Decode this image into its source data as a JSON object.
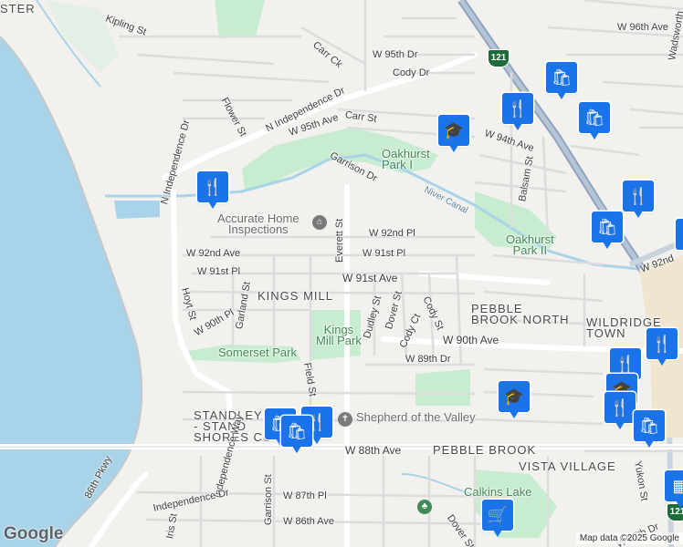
{
  "labels": {
    "ster": "STER",
    "kipling": "Kipling St",
    "carr_ck": "Carr Ck",
    "w95th_dr": "W 95th Dr",
    "cody_dr": "Cody Dr",
    "n_indep_dr": "N Independence Dr",
    "w95th_ave": "W 95th Ave",
    "carr_st": "Carr St",
    "flower_st": "Flower St",
    "indep_dr": "N Independence Dr",
    "garrison_dr": "Garrison Dr",
    "oakhurst_park1": "Oakhurst\nPark I",
    "w94th_ave": "W 94th Ave",
    "balsam_st": "Balsam St",
    "w96th_ave": "W 96th Ave",
    "wadsworth": "Wadsworth",
    "niver_canal": "Niver Canal",
    "w92nd_pl": "W 92nd Pl",
    "w91st_pl_n": "W 91st Pl",
    "w92nd_ave": "W 92nd Ave",
    "w91st_pl": "W 91st Pl",
    "w91st_ave": "W 91st Ave",
    "everett_st": "Everett St",
    "oakhurst_park2": "Oakhurst\nPark II",
    "w92nd_ave_e": "W 92nd",
    "kings_mill": "KINGS MILL",
    "hoyt_st": "Hoyt St",
    "w90th_pl": "W 90th Pl",
    "garland_st": "Garland St",
    "dudley_st": "Dudley St",
    "dover_st": "Dover St",
    "cody_ct": "Cody Ct",
    "cody_st": "Cody St",
    "pebble_brook_north": "PEBBLE\nBROOK NORTH",
    "wildridge_town": "WILDRIDGE\nTOWN",
    "w90th_ave": "W 90th Ave",
    "kings_mill_park": "Kings\nMill Park",
    "somerset_park": "Somerset Park",
    "w89th_dr": "W 89th Dr",
    "field_st": "Field St",
    "standley_shores": "STANDLEY\n- STAND\nSHORES CO",
    "shepherd": "Shepherd of the Valley",
    "w88th_ave": "W 88th Ave",
    "pebble_brook": "PEBBLE BROOK",
    "vista_village": "VISTA VILLAGE",
    "yukon_st": "Yukon St",
    "86th_pkwy": "86th Pkwy",
    "independence_way": "Independence Way",
    "garrison_st": "Garrison St",
    "indep_dr_s": "Independence Dr",
    "w87th_pl": "W 87th Pl",
    "iris_st": "Iris St",
    "w86th_ave": "W 86th Ave",
    "calkins_lake": "Calkins Lake",
    "dover_st_s": "Dover St",
    "w87th_dr": "W 87th Dr",
    "accurate_home": "Accurate Home\nInspections",
    "rt121": "121",
    "rt121b": "121"
  },
  "attribution": {
    "logo": "Google",
    "credit": "Map data ©2025 Google"
  },
  "icons": {
    "shopping": "shopping-bag",
    "restaurant": "fork-knife",
    "school": "graduation-cap",
    "grocery": "shopping-cart",
    "park": "tree",
    "service": "house-icon"
  },
  "colors": {
    "water": "#a8d3e8",
    "park": "#c7ecd0",
    "highway": "#9cb0c8",
    "pin": "#1a73e8"
  }
}
